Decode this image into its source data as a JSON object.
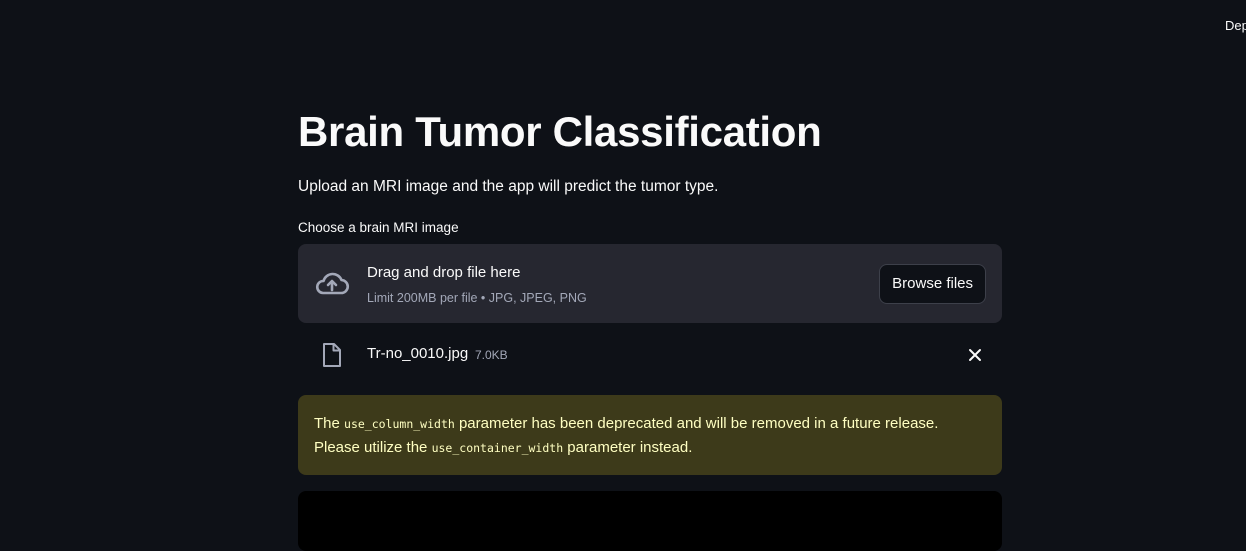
{
  "header": {
    "deploy_label": "Deploy"
  },
  "page": {
    "title": "Brain Tumor Classification",
    "subtitle": "Upload an MRI image and the app will predict the tumor type."
  },
  "uploader": {
    "label": "Choose a brain MRI image",
    "drop_title": "Drag and drop file here",
    "drop_limit": "Limit 200MB per file • JPG, JPEG, PNG",
    "browse_label": "Browse files",
    "upload_icon": "cloud-upload-icon"
  },
  "uploaded_file": {
    "name": "Tr-no_0010.jpg",
    "size": "7.0KB",
    "file_icon": "file-icon",
    "remove_icon": "close-icon"
  },
  "warning": {
    "text_before": "The ",
    "code_1": "use_column_width",
    "text_middle": " parameter has been deprecated and will be removed in a future release. Please utilize the ",
    "code_2": "use_container_width",
    "text_after": " parameter instead."
  },
  "colors": {
    "background": "#0e1117",
    "dropzone": "#262730",
    "warning_bg": "#3d3a1a",
    "warning_text": "#ffffc2",
    "muted_text": "#a3a8b8"
  }
}
